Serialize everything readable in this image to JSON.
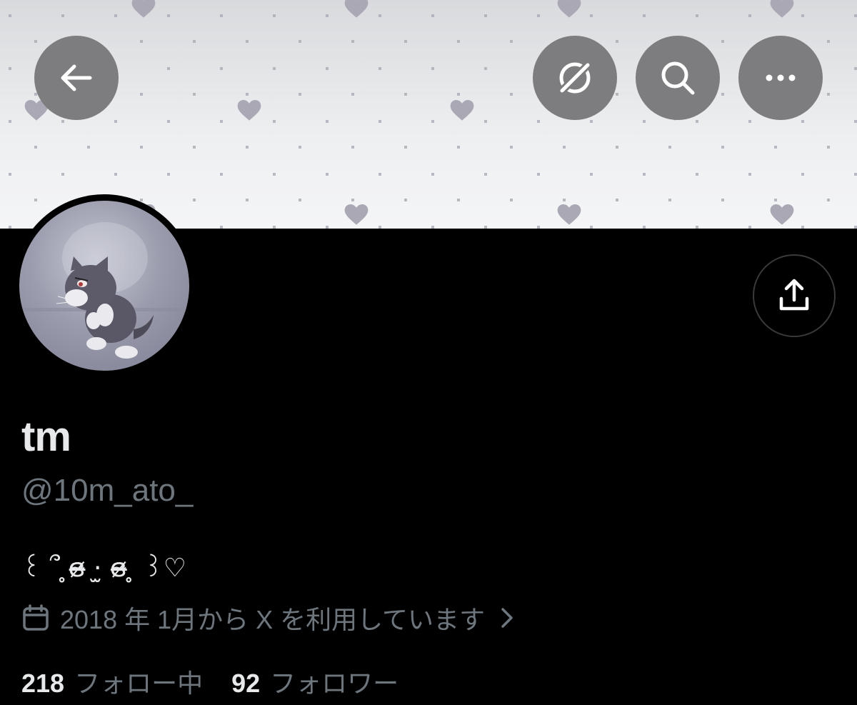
{
  "header": {
    "back_icon": "arrow-left-icon",
    "actions": [
      "translate-slash-icon",
      "search-icon",
      "more-dots-icon"
    ]
  },
  "profile": {
    "name": "tm",
    "handle": "@10m_ato_",
    "bio": "꒰ ՞ ̥ɞ̴̶̷ ·̫ ɞ̴̶̷ ̥ ꒱♡",
    "joined": "2018 年 1月から X を利用しています",
    "share_icon": "share-upload-icon"
  },
  "stats": {
    "following_count": "218",
    "following_label": "フォロー中",
    "followers_count": "92",
    "followers_label": "フォロワー"
  },
  "colors": {
    "background": "#000000",
    "primary_text": "#e7e9ea",
    "secondary_text": "#6e767d",
    "button_bg": "#7d7d80",
    "banner_heart": "#a9a8b4"
  }
}
